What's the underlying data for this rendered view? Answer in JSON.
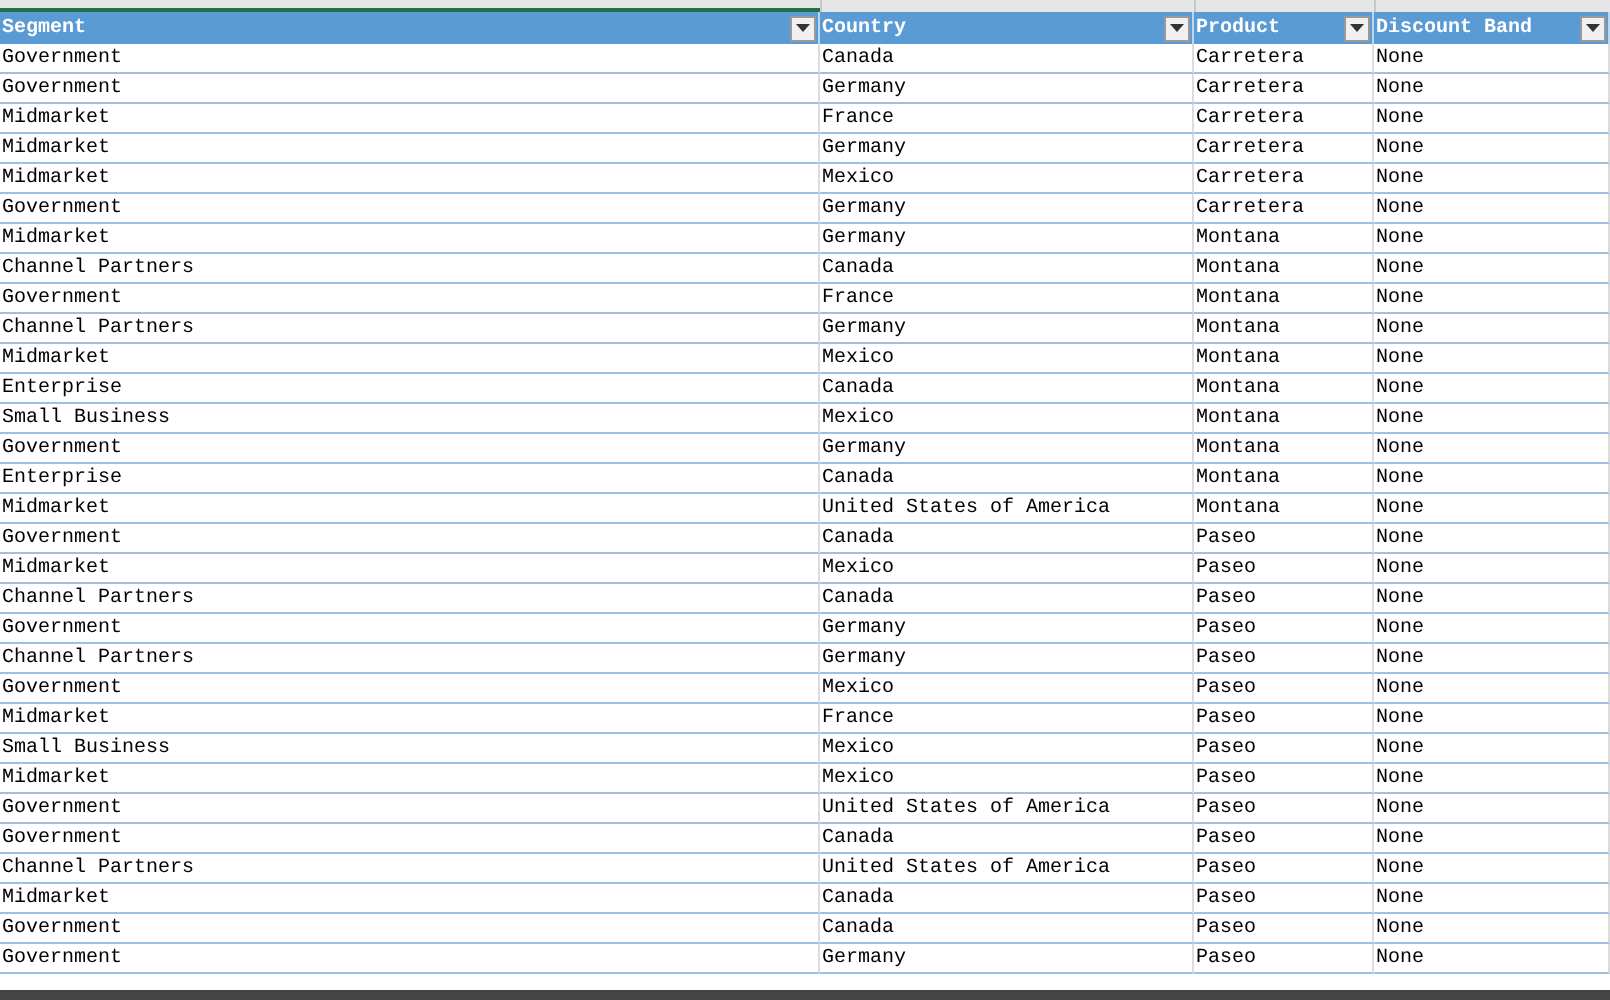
{
  "table": {
    "columns": [
      {
        "label": "Segment"
      },
      {
        "label": "Country"
      },
      {
        "label": "Product"
      },
      {
        "label": "Discount Band"
      }
    ],
    "rows": [
      [
        "Government",
        "Canada",
        "Carretera",
        "None"
      ],
      [
        "Government",
        "Germany",
        "Carretera",
        "None"
      ],
      [
        "Midmarket",
        "France",
        "Carretera",
        "None"
      ],
      [
        "Midmarket",
        "Germany",
        "Carretera",
        "None"
      ],
      [
        "Midmarket",
        "Mexico",
        "Carretera",
        "None"
      ],
      [
        "Government",
        "Germany",
        "Carretera",
        "None"
      ],
      [
        "Midmarket",
        "Germany",
        "Montana",
        "None"
      ],
      [
        "Channel Partners",
        "Canada",
        "Montana",
        "None"
      ],
      [
        "Government",
        "France",
        "Montana",
        "None"
      ],
      [
        "Channel Partners",
        "Germany",
        "Montana",
        "None"
      ],
      [
        "Midmarket",
        "Mexico",
        "Montana",
        "None"
      ],
      [
        "Enterprise",
        "Canada",
        "Montana",
        "None"
      ],
      [
        "Small Business",
        "Mexico",
        "Montana",
        "None"
      ],
      [
        "Government",
        "Germany",
        "Montana",
        "None"
      ],
      [
        "Enterprise",
        "Canada",
        "Montana",
        "None"
      ],
      [
        "Midmarket",
        "United States of America",
        "Montana",
        "None"
      ],
      [
        "Government",
        "Canada",
        "Paseo",
        "None"
      ],
      [
        "Midmarket",
        "Mexico",
        "Paseo",
        "None"
      ],
      [
        "Channel Partners",
        "Canada",
        "Paseo",
        "None"
      ],
      [
        "Government",
        "Germany",
        "Paseo",
        "None"
      ],
      [
        "Channel Partners",
        "Germany",
        "Paseo",
        "None"
      ],
      [
        "Government",
        "Mexico",
        "Paseo",
        "None"
      ],
      [
        "Midmarket",
        "France",
        "Paseo",
        "None"
      ],
      [
        "Small Business",
        "Mexico",
        "Paseo",
        "None"
      ],
      [
        "Midmarket",
        "Mexico",
        "Paseo",
        "None"
      ],
      [
        "Government",
        "United States of America",
        "Paseo",
        "None"
      ],
      [
        "Government",
        "Canada",
        "Paseo",
        "None"
      ],
      [
        "Channel Partners",
        "United States of America",
        "Paseo",
        "None"
      ],
      [
        "Midmarket",
        "Canada",
        "Paseo",
        "None"
      ],
      [
        "Government",
        "Canada",
        "Paseo",
        "None"
      ],
      [
        "Government",
        "Germany",
        "Paseo",
        "None"
      ]
    ]
  }
}
